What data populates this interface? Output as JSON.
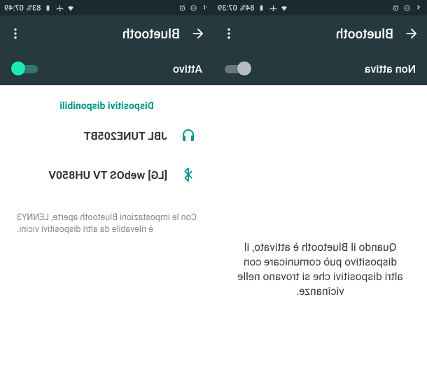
{
  "statusbar_left": {
    "time": "07:39",
    "battery_pct": "84%"
  },
  "statusbar_right": {
    "time": "07:49",
    "battery_pct": "83%"
  },
  "left": {
    "toolbar_title": "Bluetooth",
    "toggle_label": "Non attiva",
    "info_msg": "Quando il Bluetooth è attivato, il dispositivo può comunicare con altri dispositivi che si trovano nelle vicinanze."
  },
  "right": {
    "toolbar_title": "Bluetooth",
    "toggle_label": "Attivo",
    "section_title": "Dispositivi disponibili",
    "devices": [
      {
        "label": "JBL TUNE205BT"
      },
      {
        "label": "[LG] webOS TV UH850V"
      }
    ],
    "footnote": "Con le impostazioni Bluetooth aperte, LENNY3 è rilevabile da altri dispositivi vicini."
  }
}
